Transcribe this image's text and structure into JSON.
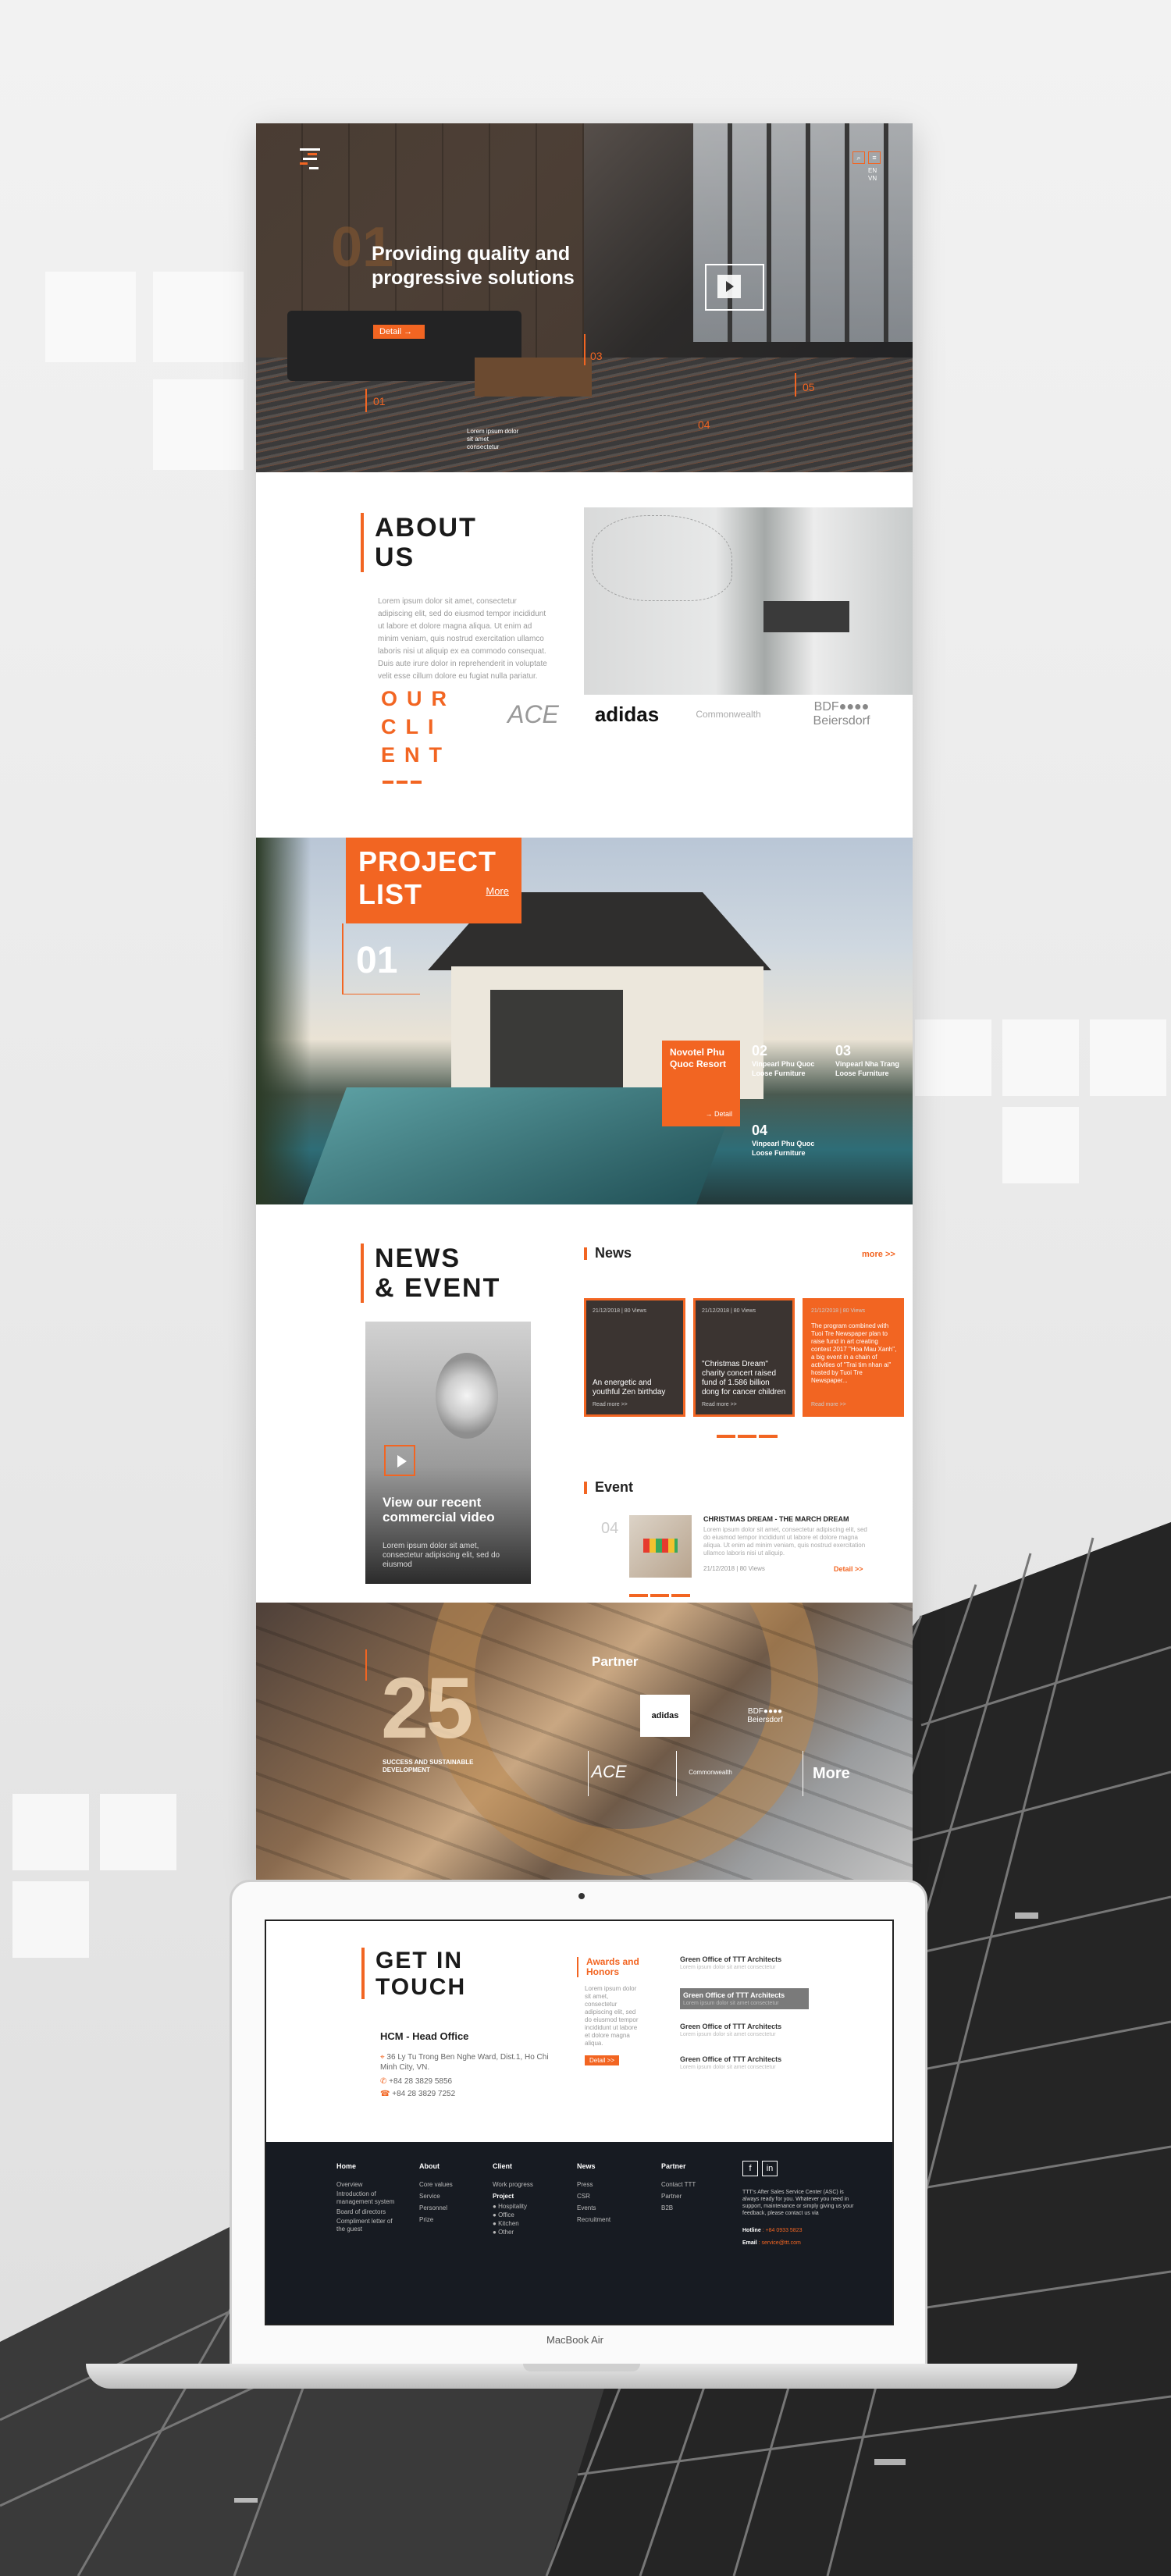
{
  "hero": {
    "title": "Providing quality and progressive solutions",
    "big_number": "01",
    "detail_label": "Detail",
    "numbers": [
      "01",
      "03",
      "04",
      "05"
    ],
    "caption": "Lorem ipsum dolor sit amet consectetur",
    "lang": [
      "EN",
      "VN"
    ]
  },
  "about": {
    "title_line1": "ABOUT",
    "title_line2": "US",
    "text": "Lorem ipsum dolor sit amet, consectetur adipiscing elit, sed do eiusmod tempor incididunt ut labore et dolore magna aliqua. Ut enim ad minim veniam, quis nostrud exercitation ullamco laboris nisi ut aliquip ex ea commodo consequat. Duis aute irure dolor in reprehenderit in voluptate velit esse cillum dolore eu fugiat nulla pariatur."
  },
  "clients": {
    "title": "OUR CLIENT",
    "title_lines": [
      "OUR",
      "CLI",
      "ENT"
    ],
    "logos": [
      "ACE",
      "adidas",
      "Commonwealth",
      "BDF●●●● Beiersdorf"
    ]
  },
  "projects": {
    "title_line1": "PROJECT",
    "title_line2": "LIST",
    "more": "More",
    "current_number": "01",
    "card_title": "Novotel Phu Quoc Resort",
    "card_detail": "→ Detail",
    "items": [
      {
        "n": "02",
        "name": "Vinpearl Phu Quoc Loose Furniture"
      },
      {
        "n": "03",
        "name": "Vinpearl Nha Trang Loose Furniture"
      },
      {
        "n": "04",
        "name": "Vinpearl Phu Quoc Loose Furniture"
      }
    ]
  },
  "news": {
    "title_line1": "NEWS",
    "title_line2": "& EVENT",
    "video_title": "View our recent commercial video",
    "video_text": "Lorem ipsum dolor sit amet, consectetur adipiscing elit, sed do eiusmod",
    "news_label": "News",
    "more": "more >>",
    "cards": [
      {
        "tag": "21/12/2018 | 80 Views",
        "title": "An energetic and youthful Zen birthday",
        "read": "Read more >>"
      },
      {
        "tag": "21/12/2018 | 80 Views",
        "title": "\"Christmas Dream\" charity concert raised fund of 1.586 billion dong for cancer children",
        "read": "Read more >>"
      },
      {
        "tag": "21/12/2018 | 80 Views",
        "title": "The program combined with Tuoi Tre Newspaper plan to raise fund in art creating contest 2017 \"Hoa Mau Xanh\", a big event in a chain of activities of \"Trai tim nhan ai\" hosted by Tuoi Tre Newspaper...",
        "read": "Read more >>"
      }
    ],
    "event_label": "Event",
    "event": {
      "num": "04",
      "title": "CHRISTMAS DREAM - THE MARCH DREAM",
      "body": "Lorem ipsum dolor sit amet, consectetur adipiscing elit, sed do eiusmod tempor incididunt ut labore et dolore magna aliqua. Ut enim ad minim veniam, quis nostrud exercitation ullamco laboris nisi ut aliquip.",
      "meta": "21/12/2018 | 80 Views",
      "detail": "Detail >>"
    }
  },
  "partner": {
    "big": "25",
    "caption": "SUCCESS AND SUSTAINABLE DEVELOPMENT",
    "title": "Partner",
    "logos": [
      "adidas",
      "BDF●●●● Beiersdorf",
      "ACE",
      "Commonwealth"
    ],
    "more": "More"
  },
  "contact": {
    "title_line1": "GET IN",
    "title_line2": "TOUCH",
    "office": "HCM - Head Office",
    "address": "36 Ly Tu Trong Ben Nghe Ward, Dist.1, Ho Chi Minh City, VN.",
    "phone": "+84 28 3829 5856",
    "fax": "+84 28 3829 7252",
    "awards_title": "Awards and Honors",
    "awards_text": "Lorem ipsum dolor sit amet, consectetur adipiscing elit, sed do eiusmod tempor incididunt ut labore et dolore magna aliqua.",
    "awards_btn": "Detail >>",
    "award_items": [
      {
        "title": "Green Office of TTT Architects",
        "sub": "Lorem ipsum dolor sit amet consectetur"
      },
      {
        "title": "Green Office of TTT Architects",
        "sub": "Lorem ipsum dolor sit amet consectetur"
      },
      {
        "title": "Green Office of TTT Architects",
        "sub": "Lorem ipsum dolor sit amet consectetur"
      },
      {
        "title": "Green Office of TTT Architects",
        "sub": "Lorem ipsum dolor sit amet consectetur"
      }
    ]
  },
  "footer": {
    "home": {
      "h": "Home",
      "items": [
        "Overview",
        "Introduction of management system",
        "Board of directors",
        "Compliment letter of the guest"
      ]
    },
    "about": {
      "h": "About",
      "items": [
        "Core values",
        "Service",
        "Personnel",
        "Prize"
      ]
    },
    "client": {
      "h": "Client",
      "items": [
        "Work progress",
        "Project",
        "Hospitality",
        "Office",
        "Kitchen",
        "Other"
      ]
    },
    "news": {
      "h": "News",
      "items": [
        "Press",
        "CSR",
        "Events",
        "Recruitment"
      ]
    },
    "partner": {
      "h": "Partner",
      "items": [
        "Contact TTT",
        "Partner",
        "B2B"
      ]
    },
    "social": [
      "f",
      "in"
    ],
    "support_text": "TTT's After Sales Service Center (ASC) is always ready for you. Whatever you need in support, maintenance or simply giving us your feedback, please contact us via",
    "hotline_label": "Hotline",
    "hotline": ": +84 0933 5823",
    "email_label": "Email",
    "email": ": service@ttt.com"
  },
  "laptop": {
    "label": "MacBook Air"
  },
  "colors": {
    "accent": "#f26522",
    "dark": "#171b22"
  }
}
